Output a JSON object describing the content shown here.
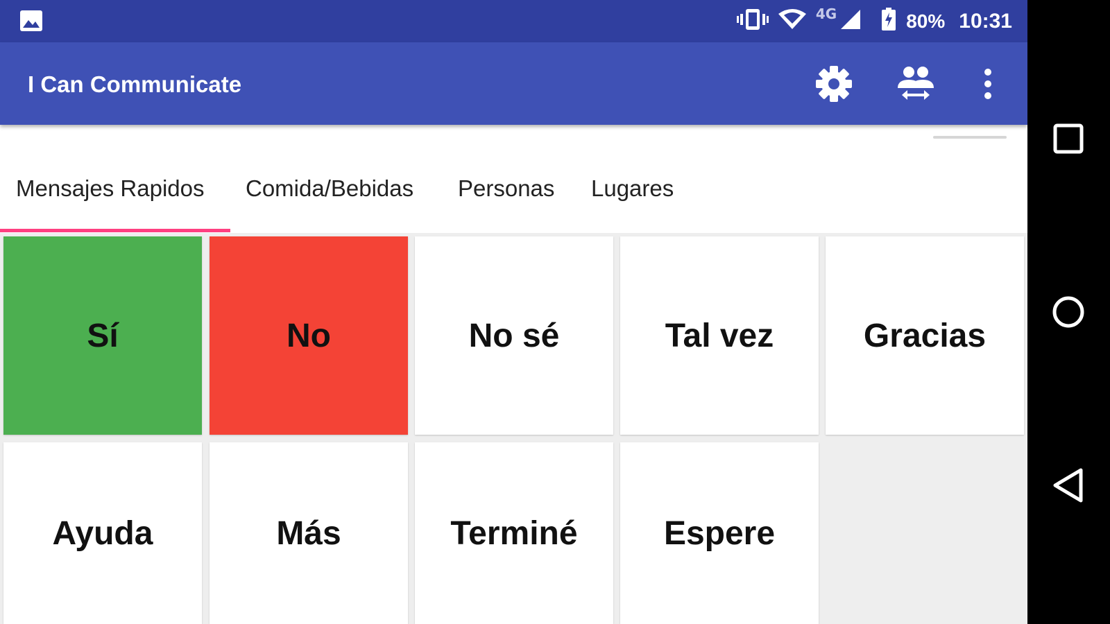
{
  "status_bar": {
    "network_label": "4G",
    "battery": "80%",
    "time": "10:31",
    "icons": [
      "image-icon",
      "vibrate-icon",
      "wifi-icon",
      "signal-icon",
      "battery-charging-icon"
    ]
  },
  "app_bar": {
    "title": "I Can Communicate",
    "actions": [
      "settings-icon",
      "switch-user-icon",
      "more-vert-icon"
    ]
  },
  "tabs": [
    {
      "label": "Mensajes Rapidos",
      "selected": true
    },
    {
      "label": "Comida/Bebidas",
      "selected": false
    },
    {
      "label": "Personas",
      "selected": false
    },
    {
      "label": "Lugares",
      "selected": false
    }
  ],
  "tiles": [
    {
      "label": "Sí",
      "color": "#4caf50"
    },
    {
      "label": "No",
      "color": "#f44336"
    },
    {
      "label": "No sé",
      "color": "#ffffff"
    },
    {
      "label": "Tal vez",
      "color": "#ffffff"
    },
    {
      "label": "Gracias",
      "color": "#ffffff"
    },
    {
      "label": "Ayuda",
      "color": "#ffffff"
    },
    {
      "label": "Más",
      "color": "#ffffff"
    },
    {
      "label": "Terminé",
      "color": "#ffffff"
    },
    {
      "label": "Espere",
      "color": "#ffffff"
    }
  ],
  "colors": {
    "status_bar": "#303f9f",
    "app_bar": "#3f51b5",
    "tab_indicator": "#ff4081"
  },
  "nav_bar": [
    "recents-icon",
    "home-icon",
    "back-icon"
  ]
}
